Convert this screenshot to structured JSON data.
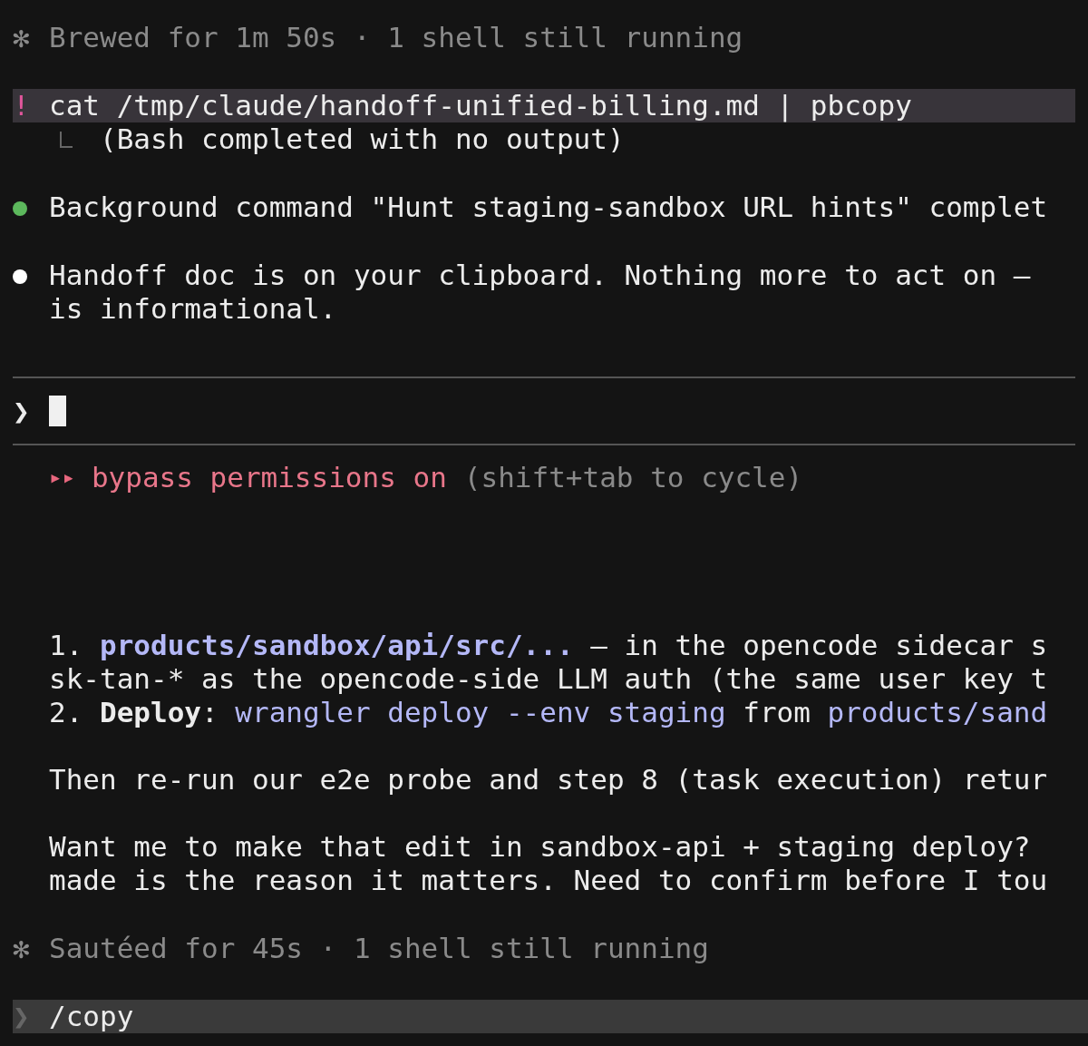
{
  "status_top": {
    "icon": "✻",
    "text": "Brewed for 1m 50s · 1 shell still running"
  },
  "bash": {
    "prefix": "!",
    "command": "cat /tmp/claude/handoff-unified-billing.md | pbcopy",
    "output": "(Bash completed with no output)"
  },
  "messages": [
    {
      "color": "#5cb85c",
      "lines": [
        "Background command \"Hunt staging-sandbox URL hints\" complet"
      ]
    },
    {
      "color": "#ffffff",
      "lines": [
        "Handoff doc is on your clipboard. Nothing more to act on —",
        "is informational."
      ]
    }
  ],
  "prompt": {
    "symbol": "❯"
  },
  "mode": {
    "icon": "▸▸",
    "label": "bypass permissions on",
    "hint": "(shift+tab to cycle)"
  },
  "body": [
    [
      [
        {
          "kind": "plain",
          "text": "1. "
        },
        {
          "kind": "path",
          "text": "products/sandbox/api/src/..."
        },
        {
          "kind": "plain",
          "text": " — in the opencode sidecar s"
        }
      ],
      [
        {
          "kind": "plain",
          "text": "sk-tan-* as the opencode-side LLM auth (the same user key t"
        }
      ],
      [
        {
          "kind": "plain",
          "text": "2. "
        },
        {
          "kind": "bold",
          "text": "Deploy"
        },
        {
          "kind": "plain",
          "text": ": "
        },
        {
          "kind": "code",
          "text": "wrangler deploy --env staging"
        },
        {
          "kind": "plain",
          "text": " from "
        },
        {
          "kind": "code",
          "text": "products/sand"
        }
      ]
    ],
    [
      [
        {
          "kind": "plain",
          "text": "Then re-run our e2e probe and step 8 (task execution) retur"
        }
      ]
    ],
    [
      [
        {
          "kind": "plain",
          "text": "Want me to make that edit in sandbox-api + staging deploy?"
        }
      ],
      [
        {
          "kind": "plain",
          "text": "made is the reason it matters. Need to confirm before I tou"
        }
      ]
    ]
  ],
  "status_bottom": {
    "icon": "✻",
    "text": "Sautéed for 45s · 1 shell still running"
  },
  "user_command": {
    "symbol": "❯",
    "text": "/copy"
  }
}
